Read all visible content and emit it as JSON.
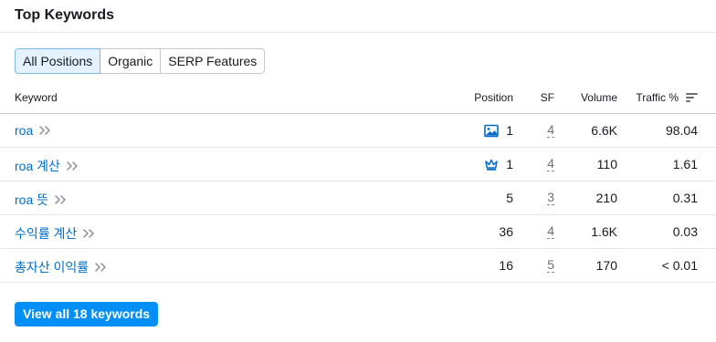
{
  "widget": {
    "title": "Top Keywords",
    "tabs": [
      {
        "label": "All Positions",
        "active": true
      },
      {
        "label": "Organic",
        "active": false
      },
      {
        "label": "SERP Features",
        "active": false
      }
    ],
    "columns": {
      "keyword": "Keyword",
      "position": "Position",
      "sf": "SF",
      "volume": "Volume",
      "traffic": "Traffic %"
    },
    "rows": [
      {
        "keyword": "roa",
        "serp_icon": "image-icon",
        "position": "1",
        "sf": "4",
        "volume": "6.6K",
        "traffic": "98.04"
      },
      {
        "keyword": "roa 계산",
        "serp_icon": "crown-icon",
        "position": "1",
        "sf": "4",
        "volume": "110",
        "traffic": "1.61"
      },
      {
        "keyword": "roa 뜻",
        "serp_icon": "",
        "position": "5",
        "sf": "3",
        "volume": "210",
        "traffic": "0.31"
      },
      {
        "keyword": "수익률 계산",
        "serp_icon": "",
        "position": "36",
        "sf": "4",
        "volume": "1.6K",
        "traffic": "0.03"
      },
      {
        "keyword": "총자산 이익률",
        "serp_icon": "",
        "position": "16",
        "sf": "5",
        "volume": "170",
        "traffic": "< 0.01"
      }
    ],
    "view_all_label": "View all 18 keywords",
    "colors": {
      "link": "#006dca",
      "button": "#008ff8",
      "active_tab_bg": "#e3f2fc",
      "serp_icon": "#006dca"
    }
  }
}
